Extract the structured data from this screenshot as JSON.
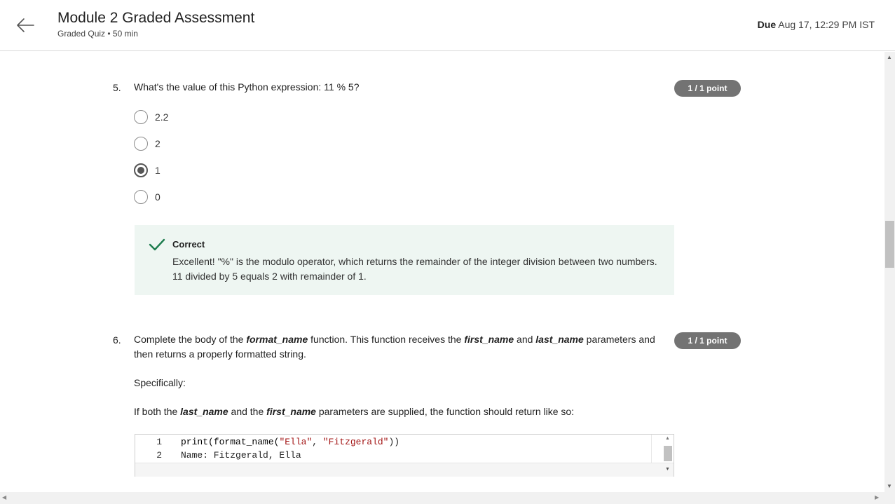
{
  "header": {
    "title": "Module 2 Graded Assessment",
    "subtitle": "Graded Quiz • 50 min",
    "due_label": "Due",
    "due_value": "Aug 17, 12:29 PM IST",
    "back_icon": "arrow-left-icon"
  },
  "questions": [
    {
      "number": "5.",
      "text": "What's the value of this Python expression: 11 % 5?",
      "points": "1 / 1 point",
      "options": [
        {
          "label": "2.2",
          "selected": false
        },
        {
          "label": "2",
          "selected": false
        },
        {
          "label": "1",
          "selected": true
        },
        {
          "label": "0",
          "selected": false
        }
      ],
      "feedback": {
        "title": "Correct",
        "text": "Excellent! \"%\" is the modulo operator, which returns the remainder of the integer division between two numbers. 11 divided by 5 equals 2 with remainder of 1.",
        "icon": "checkmark-icon",
        "color": "#1e7d4f"
      }
    },
    {
      "number": "6.",
      "text_parts": {
        "p1": "Complete the body of the ",
        "fn_name": "format_name",
        "p2": " function. This function receives the ",
        "first_name": "first_name",
        "p3": " and ",
        "last_name": "last_name",
        "p4": " parameters and then returns a properly formatted string."
      },
      "points": "1 / 1 point",
      "specifically": "Specifically:",
      "rule": {
        "p1": "If both the ",
        "last_name": "last_name",
        "p2": " and the ",
        "first_name": "first_name",
        "p3": " parameters are supplied, the function should return like so:"
      },
      "code": {
        "lines": [
          {
            "num": "1",
            "fn": "print(format_name(",
            "s1": "\"Ella\"",
            "sep": ", ",
            "s2": "\"Fitzgerald\"",
            "end": "))"
          },
          {
            "num": "2",
            "text": "Name: Fitzgerald, Ella"
          }
        ]
      }
    }
  ],
  "colors": {
    "badge_bg": "#737373",
    "feedback_bg": "#eef6f2",
    "string_literal": "#a31515"
  }
}
